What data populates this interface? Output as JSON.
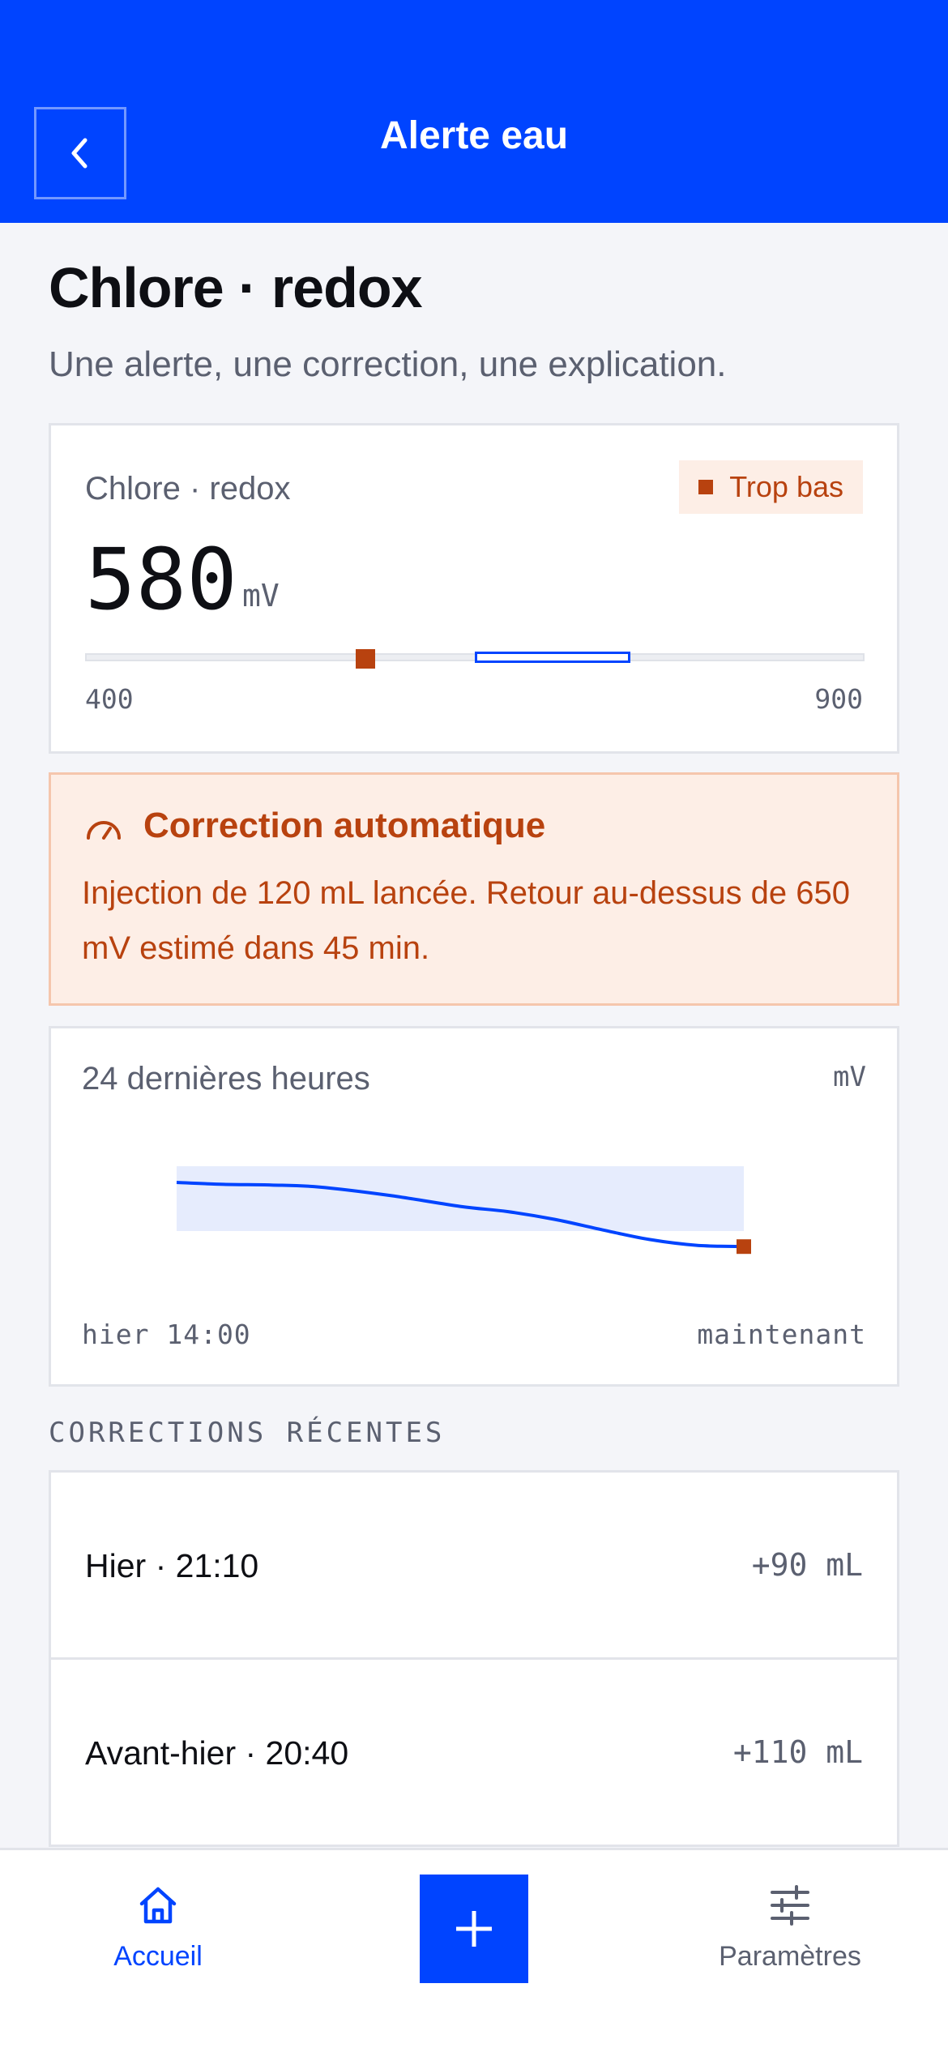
{
  "header": {
    "title": "Alerte eau",
    "back_icon": "chevron-left-icon"
  },
  "page": {
    "title": "Chlore · redox",
    "subtitle": "Une alerte, une correction, une explication."
  },
  "reading": {
    "label": "Chlore · redox",
    "status": "Trop bas",
    "value": "580",
    "value_num": 580,
    "unit": "mV",
    "range_min": 400,
    "range_max": 900,
    "range_min_label": "400",
    "range_max_label": "900",
    "target_min": 650,
    "target_max": 750,
    "colors": {
      "alert": "#b8420f",
      "accent": "#0044ff"
    }
  },
  "correction": {
    "icon": "gauge-icon",
    "title": "Correction automatique",
    "text": "Injection de 120 mL lancée. Retour au-dessus de 650 mV estimé dans 45 min."
  },
  "chart": {
    "label": "24 dernières heures",
    "unit": "mV",
    "x_start": "hier 14:00",
    "x_end": "maintenant"
  },
  "chart_data": {
    "type": "line",
    "title": "24 dernières heures",
    "ylabel": "mV",
    "xlim": [
      0,
      24
    ],
    "ylim": [
      550,
      800
    ],
    "target_band": [
      650,
      750
    ],
    "series": [
      {
        "x": [
          0,
          2,
          4,
          6,
          9,
          12,
          14,
          16,
          18,
          20,
          22,
          24
        ],
        "values": [
          725,
          722,
          721,
          718,
          705,
          688,
          680,
          668,
          652,
          637,
          628,
          626
        ]
      }
    ]
  },
  "corrections": {
    "section_title": "CORRECTIONS RÉCENTES",
    "items": [
      {
        "date": "Hier · 21:10",
        "amount": "+90 mL"
      },
      {
        "date": "Avant-hier · 20:40",
        "amount": "+110 mL"
      }
    ]
  },
  "nav": {
    "home": {
      "label": "Accueil",
      "icon": "home-icon"
    },
    "add": {
      "icon": "plus-icon"
    },
    "settings": {
      "label": "Paramètres",
      "icon": "sliders-icon"
    }
  }
}
